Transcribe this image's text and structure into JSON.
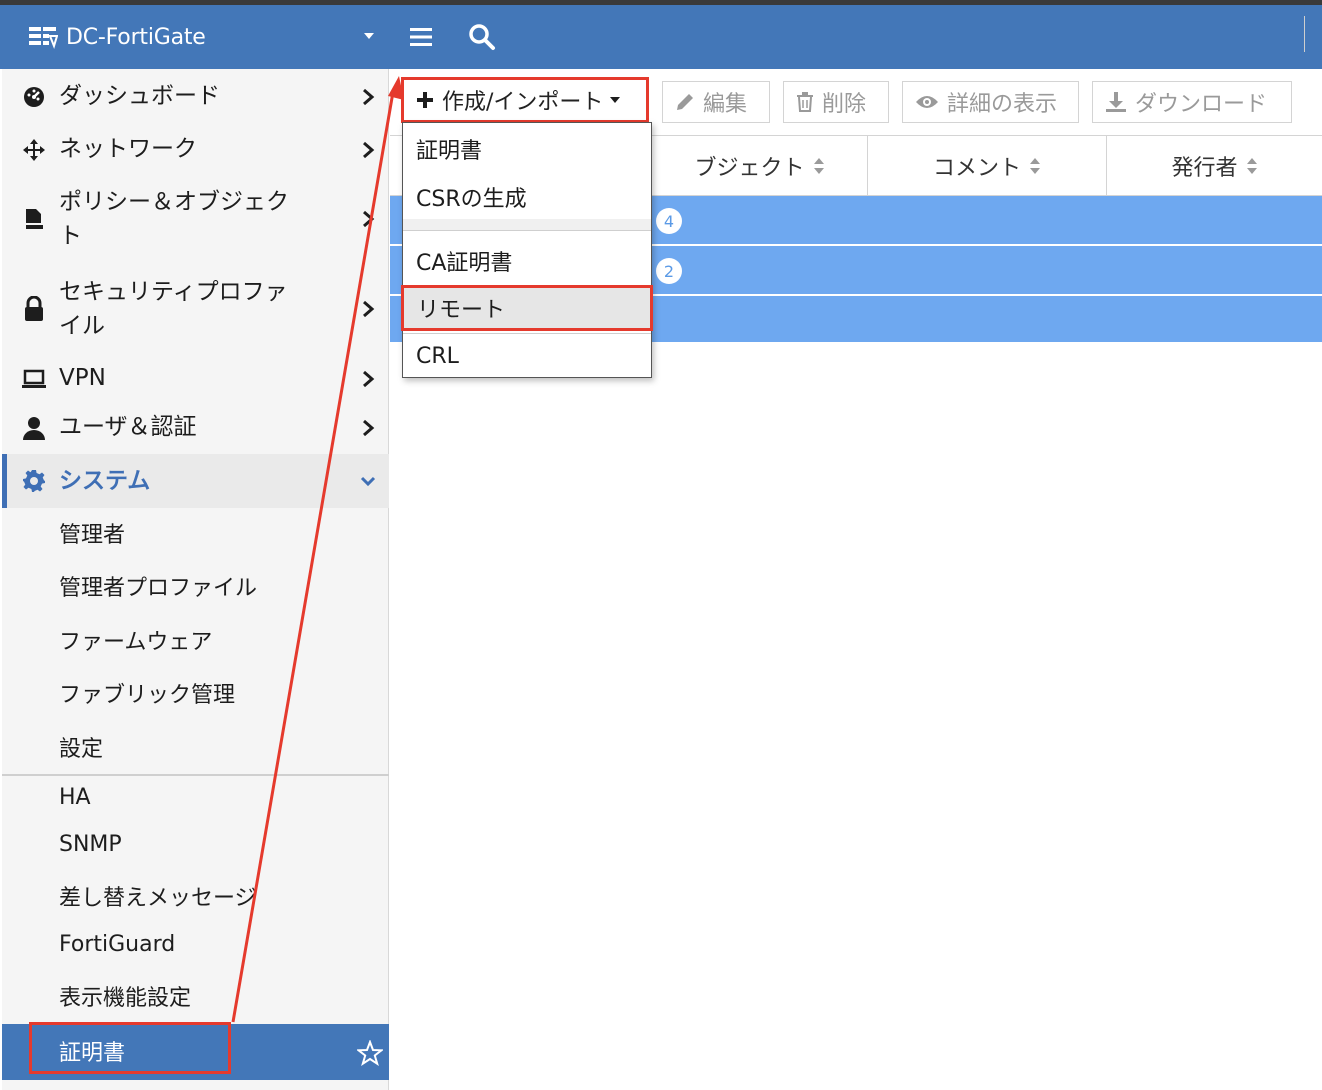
{
  "header": {
    "brand": "DC-FortiGate",
    "bg_color": "#4377b8",
    "icons": [
      "fortigate-logo-icon",
      "caret-down-icon",
      "hamburger-menu-icon",
      "search-icon"
    ]
  },
  "sidebar": {
    "items": [
      {
        "label": "ダッシュボード",
        "icon": "dashboard-icon"
      },
      {
        "label": "ネットワーク",
        "icon": "network-arrows-icon"
      },
      {
        "label_line1": "ポリシー＆オブジェク",
        "label_line2": "ト",
        "icon": "policy-doc-icon"
      },
      {
        "label_line1": "セキュリティプロファ",
        "label_line2": "イル",
        "icon": "lock-icon"
      },
      {
        "label": "VPN",
        "icon": "laptop-icon"
      },
      {
        "label": "ユーザ＆認証",
        "icon": "user-icon"
      },
      {
        "label": "システム",
        "icon": "gear-icon"
      }
    ],
    "system_subitems": [
      "管理者",
      "管理者プロファイル",
      "ファームウェア",
      "ファブリック管理",
      "設定",
      "HA",
      "SNMP",
      "差し替えメッセージ",
      "FortiGuard",
      "表示機能設定",
      "証明書"
    ],
    "active_subitem": "証明書"
  },
  "toolbar": {
    "create_label": "作成/インポート",
    "edit_label": "編集",
    "delete_label": "削除",
    "view_label": "詳細の表示",
    "download_label": "ダウンロード"
  },
  "table": {
    "columns": [
      "ブジェクト",
      "コメント",
      "発行者"
    ],
    "rows": [
      {
        "badge": "4"
      },
      {
        "badge": "2"
      },
      {
        "badge": ""
      }
    ],
    "row_color": "#6ea8f0"
  },
  "dropdown": {
    "items": [
      "証明書",
      "CSRの生成",
      "CA証明書",
      "リモート",
      "CRL"
    ],
    "highlighted": "リモート"
  },
  "annotation_color": "#e53a2d"
}
